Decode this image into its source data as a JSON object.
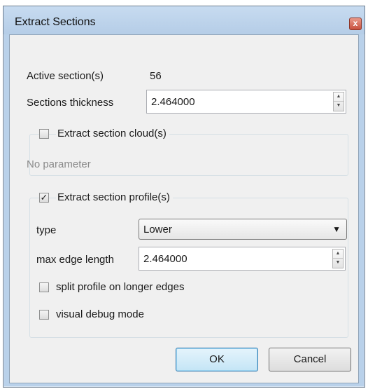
{
  "window": {
    "title": "Extract Sections",
    "close_glyph": "x"
  },
  "active_sections": {
    "label": "Active section(s)",
    "value": "56"
  },
  "thickness": {
    "label": "Sections thickness",
    "value": "2.464000"
  },
  "clouds_group": {
    "label": "Extract section cloud(s)",
    "checked": false,
    "no_param_text": "No parameter"
  },
  "profiles_group": {
    "label": "Extract section profile(s)",
    "checked": true,
    "type_label": "type",
    "type_value": "Lower",
    "max_edge_label": "max edge length",
    "max_edge_value": "2.464000",
    "split_label": "split profile on longer edges",
    "split_checked": false,
    "debug_label": "visual debug mode",
    "debug_checked": false
  },
  "buttons": {
    "ok": "OK",
    "cancel": "Cancel"
  },
  "glyphs": {
    "check": "✓",
    "up": "▲",
    "down": "▼",
    "dropdown": "▼"
  }
}
